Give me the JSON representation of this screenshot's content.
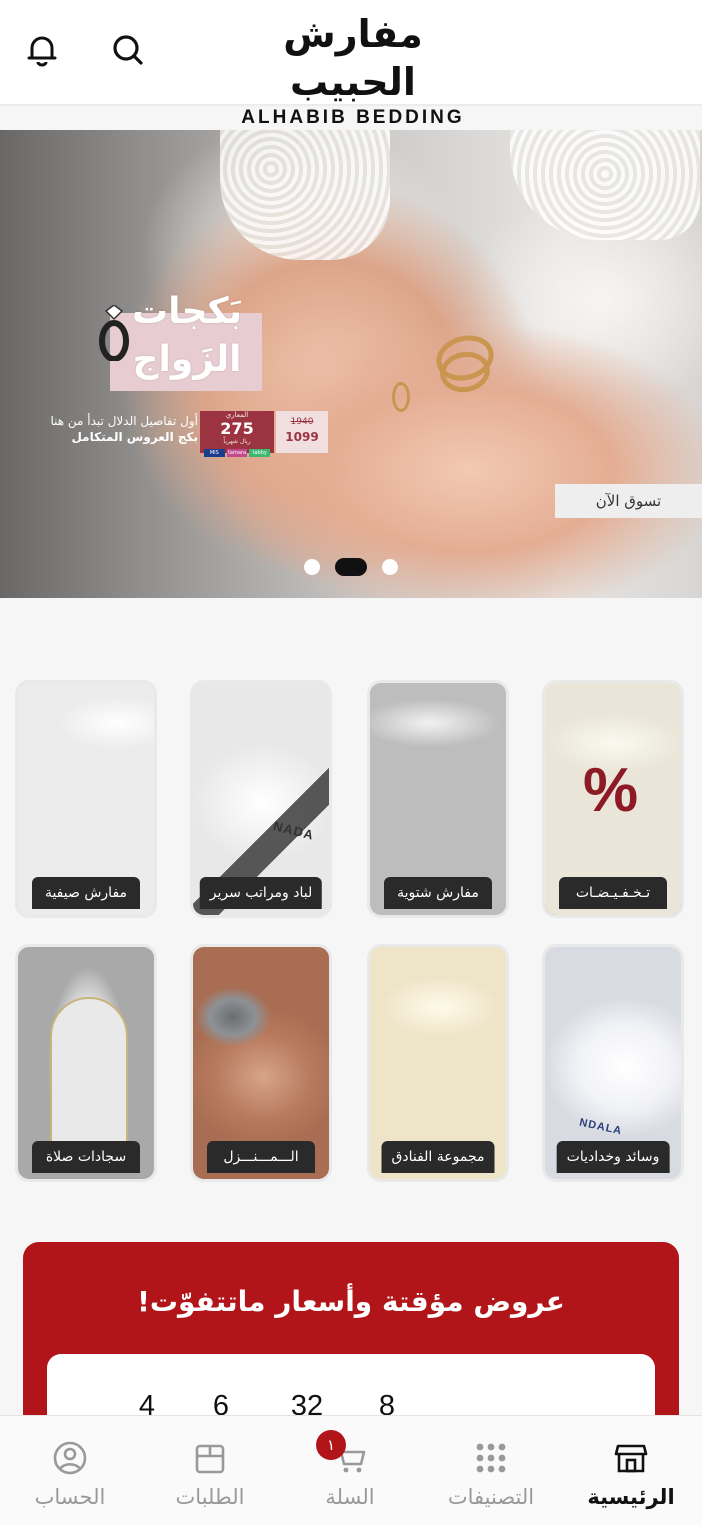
{
  "header": {
    "logo_ar": "مفارش الحبيب",
    "logo_en": "ALHABIB BEDDING",
    "icons": {
      "notifications": "bell-icon",
      "search": "search-icon"
    }
  },
  "hero": {
    "promo_title_line1": "بَكجات",
    "promo_title_line2": "الزَواج",
    "promo_line1": "أول تفاصيل الدلال تبدأ من هنا",
    "promo_line2": "بكج العروس المتكامل",
    "price_now_label": "المعاري",
    "price_now": "275",
    "price_now_note": "ريال شهرياً",
    "price_old": "1940",
    "price_new": "1099",
    "payment_logos": [
      "MIS",
      "tamara",
      "tabby"
    ],
    "shop_now": "تسوق الآن",
    "slides_count": 3,
    "active_slide": 2
  },
  "categories": [
    {
      "label": "تـخـفـيـضـات",
      "image": "sale",
      "overlay": "%"
    },
    {
      "label": "مفارش شتوية",
      "image": "winter"
    },
    {
      "label": "لباد ومراتب سرير",
      "image": "mattress",
      "overlay": "NADA"
    },
    {
      "label": "مفارش صيفية",
      "image": "summer"
    },
    {
      "label": "وسائد وخداديات",
      "image": "pillows",
      "overlay": "NDALA"
    },
    {
      "label": "مجموعة الفنادق",
      "image": "hotel"
    },
    {
      "label": "الـــمـــنـــزل",
      "image": "home"
    },
    {
      "label": "سجادات صلاة",
      "image": "prayer"
    }
  ],
  "offers": {
    "title": "عروض مؤقتة وأسعار ماتتفوّت!",
    "countdown": [
      "4",
      "6",
      "32",
      "8"
    ]
  },
  "bottom_nav": {
    "items": [
      {
        "label": "الرئيسية",
        "icon": "store-icon",
        "active": true
      },
      {
        "label": "التصنيفات",
        "icon": "grid-dots-icon",
        "active": false
      },
      {
        "label": "السلة",
        "icon": "cart-icon",
        "active": false,
        "badge": "١"
      },
      {
        "label": "الطلبات",
        "icon": "box-icon",
        "active": false
      },
      {
        "label": "الحساب",
        "icon": "user-circle-icon",
        "active": false
      }
    ]
  },
  "colors": {
    "brand_red": "#b1151a",
    "header_bg": "#ffffff",
    "page_bg": "#f6f6f6",
    "label_bg": "#2a2a2a"
  }
}
